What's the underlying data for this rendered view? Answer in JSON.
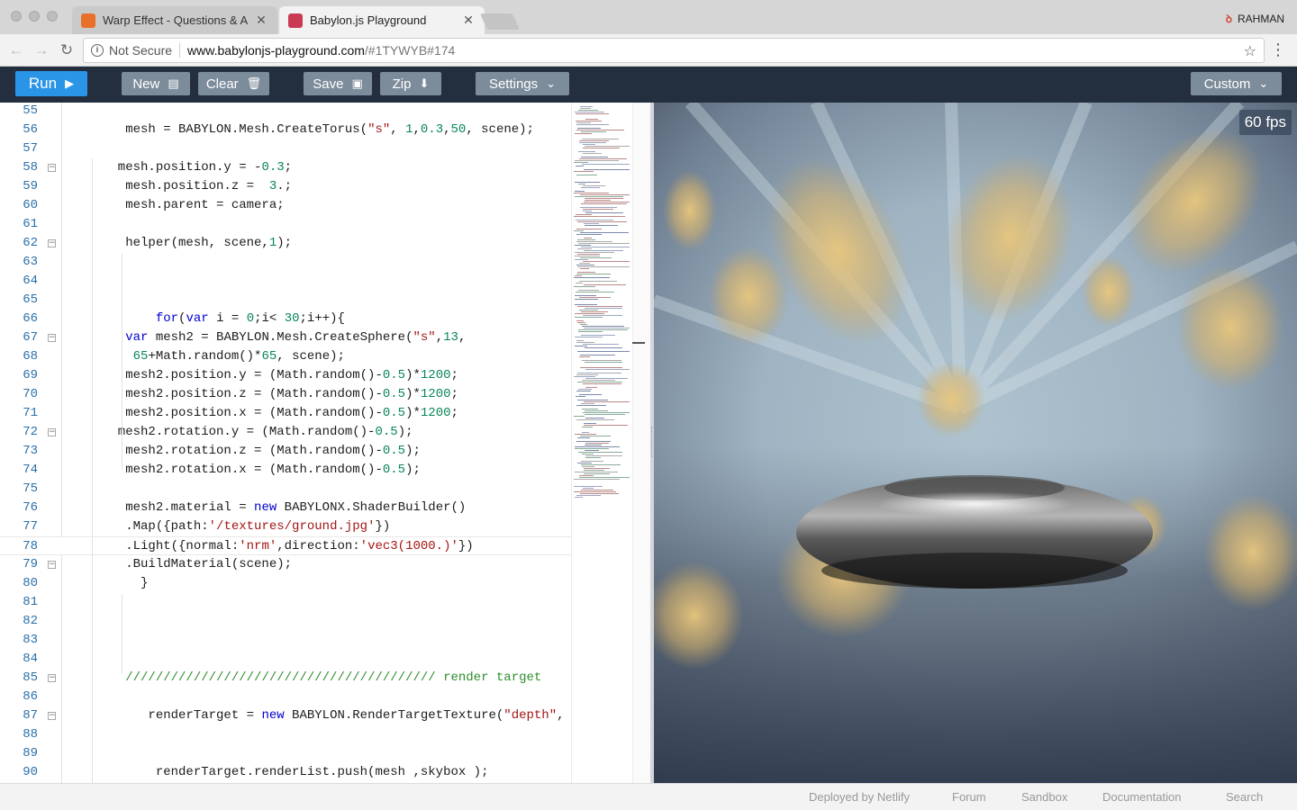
{
  "browser": {
    "tabs": [
      {
        "title": "Warp Effect - Questions & Ans"
      },
      {
        "title": "Babylon.js Playground"
      }
    ],
    "profile_name": "RAHMAN",
    "address": {
      "security_label": "Not Secure",
      "url_host": "www.babylonjs-playground.com",
      "url_rest": "/#1TYWYB#174"
    }
  },
  "toolbar": {
    "run": "Run",
    "new": "New",
    "clear": "Clear",
    "save": "Save",
    "zip": "Zip",
    "settings": "Settings",
    "custom": "Custom"
  },
  "editor": {
    "lines": [
      {
        "n": "55",
        "text": ""
      },
      {
        "n": "56",
        "text": "        mesh = BABYLON.Mesh.CreateTorus(\"s\", 1,0.3,50, scene);"
      },
      {
        "n": "57",
        "text": ""
      },
      {
        "n": "58",
        "text": "       mesh.position.y = -0.3;",
        "fold": true
      },
      {
        "n": "59",
        "text": "        mesh.position.z =  3.;"
      },
      {
        "n": "60",
        "text": "        mesh.parent = camera;"
      },
      {
        "n": "61",
        "text": ""
      },
      {
        "n": "62",
        "text": "        helper(mesh, scene,1);",
        "fold": true
      },
      {
        "n": "63",
        "text": ""
      },
      {
        "n": "64",
        "text": ""
      },
      {
        "n": "65",
        "text": ""
      },
      {
        "n": "66",
        "text": "            for(var i = 0;i< 30;i++){"
      },
      {
        "n": "67",
        "text": "        var mesh2 = BABYLON.Mesh.CreateSphere(\"s\",13,",
        "fold": true
      },
      {
        "n": "68",
        "text": "         65+Math.random()*65, scene);"
      },
      {
        "n": "69",
        "text": "        mesh2.position.y = (Math.random()-0.5)*1200;"
      },
      {
        "n": "70",
        "text": "        mesh2.position.z = (Math.random()-0.5)*1200;"
      },
      {
        "n": "71",
        "text": "        mesh2.position.x = (Math.random()-0.5)*1200;"
      },
      {
        "n": "72",
        "text": "       mesh2.rotation.y = (Math.random()-0.5);",
        "fold": true
      },
      {
        "n": "73",
        "text": "        mesh2.rotation.z = (Math.random()-0.5);"
      },
      {
        "n": "74",
        "text": "        mesh2.rotation.x = (Math.random()-0.5);"
      },
      {
        "n": "75",
        "text": ""
      },
      {
        "n": "76",
        "text": "        mesh2.material = new BABYLONX.ShaderBuilder()"
      },
      {
        "n": "77",
        "text": "        .Map({path:'/textures/ground.jpg'})"
      },
      {
        "n": "78",
        "text": "        .Light({normal:'nrm',direction:'vec3(1000.)'})"
      },
      {
        "n": "79",
        "text": "        .BuildMaterial(scene);",
        "fold": true
      },
      {
        "n": "80",
        "text": "          }"
      },
      {
        "n": "81",
        "text": ""
      },
      {
        "n": "82",
        "text": ""
      },
      {
        "n": "83",
        "text": ""
      },
      {
        "n": "84",
        "text": ""
      },
      {
        "n": "85",
        "text": "        ///////////////////////////////////////// render target",
        "fold": true
      },
      {
        "n": "86",
        "text": ""
      },
      {
        "n": "87",
        "text": "           renderTarget = new BABYLON.RenderTargetTexture(\"depth\",",
        "fold": true
      },
      {
        "n": "88",
        "text": ""
      },
      {
        "n": "89",
        "text": ""
      },
      {
        "n": "90",
        "text": "            renderTarget.renderList.push(mesh ,skybox );"
      }
    ]
  },
  "viewport": {
    "fps": "60 fps"
  },
  "footer": {
    "links": [
      "Deployed by Netlify",
      "Forum",
      "Sandbox",
      "Documentation",
      "Search"
    ]
  },
  "colors": {
    "toolbar_bg": "#232f3e",
    "run_button": "#2a95e6",
    "toolbar_button": "#7d8c9b",
    "line_number": "#2a6fa8"
  }
}
